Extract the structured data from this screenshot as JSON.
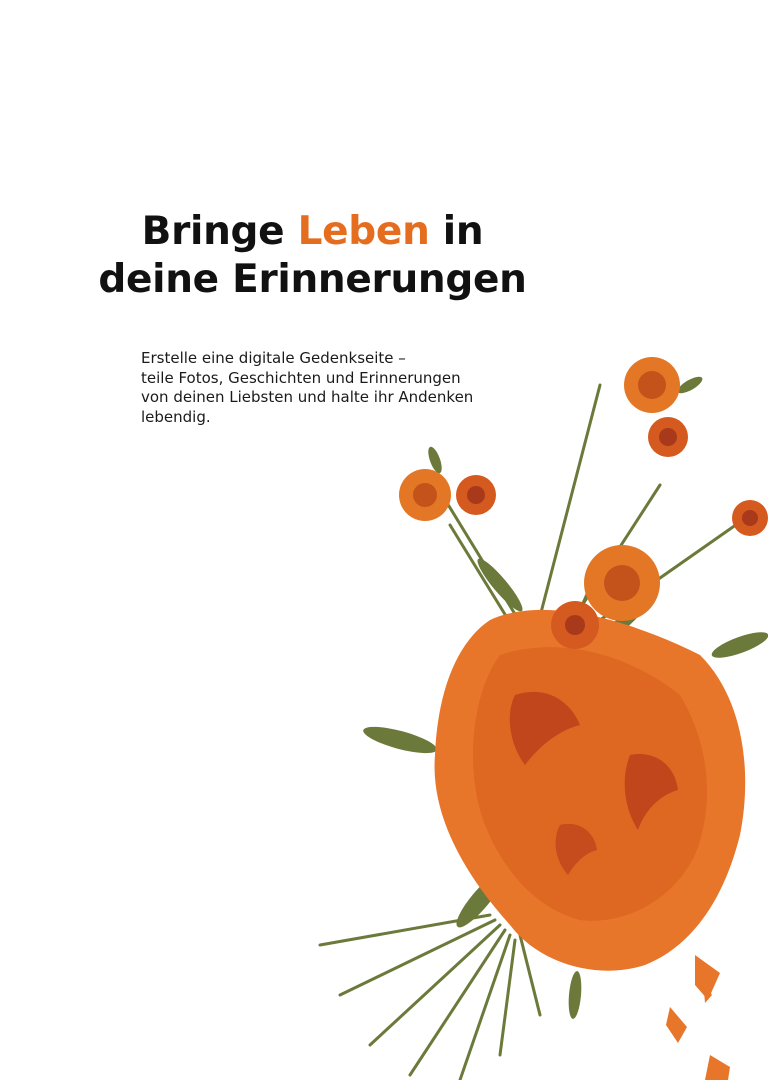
{
  "hero": {
    "headline": {
      "part_before": "Bringe ",
      "accent_word": "Leben",
      "part_after": " in",
      "line2": "deine Erinnerungen"
    },
    "lead_lines": [
      "Erstelle eine digitale Gedenkseite –",
      "teile Fotos, Geschichten und Erinnerungen",
      "von deinen Liebsten und halte ihr Andenken",
      "lebendig."
    ]
  },
  "colors": {
    "accent": "#e56d1f",
    "text": "#111111",
    "background": "#ffffff",
    "flower_orange": "#e8762a",
    "leaf_green": "#6b7a3a"
  },
  "illustration": {
    "icon": "marigold-bouquet-illustration"
  }
}
